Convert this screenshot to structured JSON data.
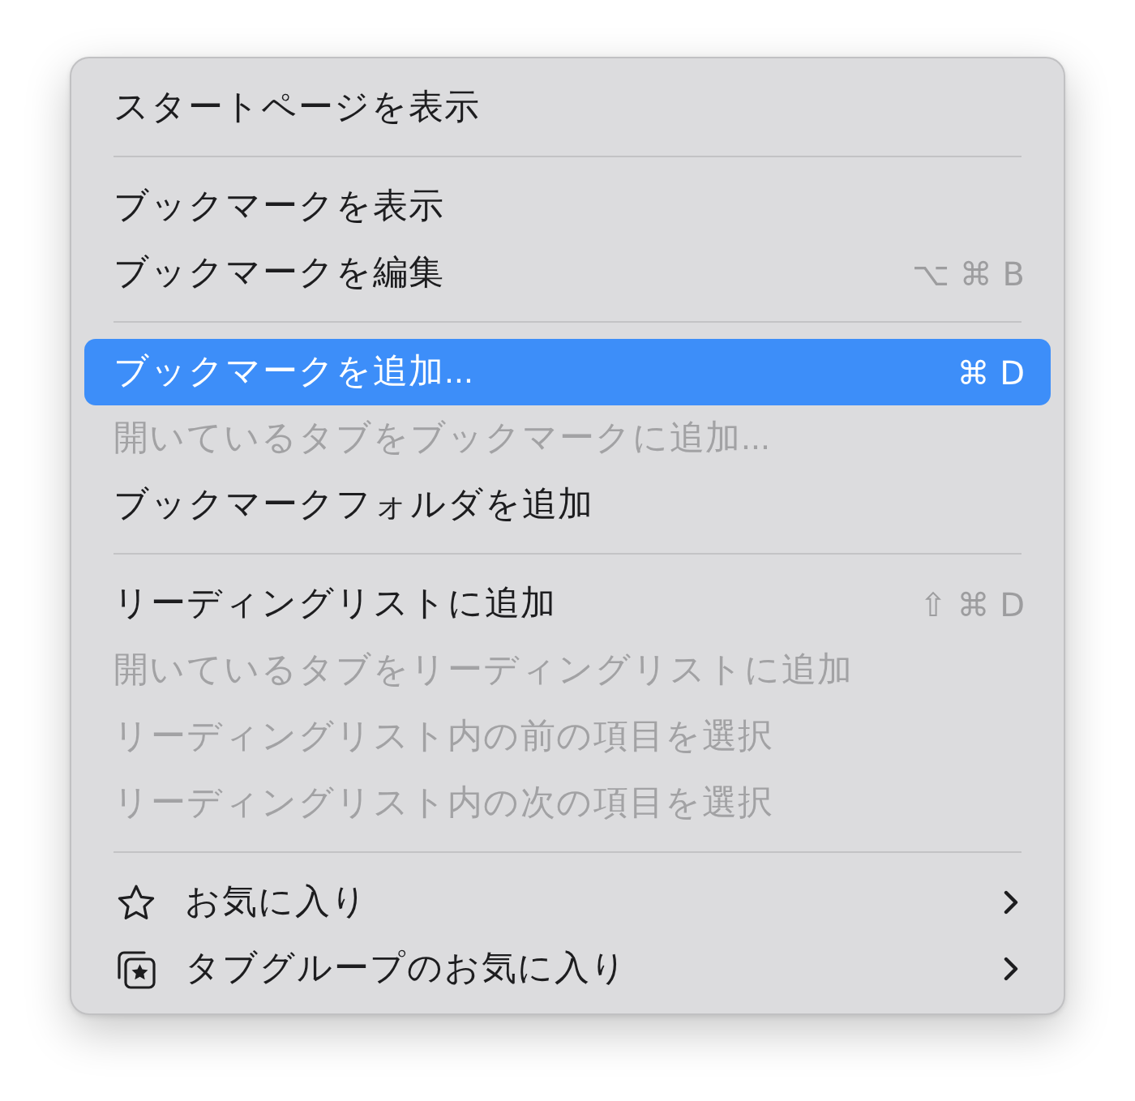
{
  "menu": {
    "sections": [
      {
        "items": [
          {
            "label": "スタートページを表示",
            "kind": "command",
            "submenu": false,
            "disabled": false,
            "selected": false
          }
        ]
      },
      {
        "items": [
          {
            "label": "ブックマークを表示",
            "kind": "command",
            "submenu": false,
            "disabled": false,
            "selected": false
          },
          {
            "label": "ブックマークを編集",
            "kind": "command",
            "shortcut": "⌥ ⌘ B",
            "submenu": false,
            "disabled": false,
            "selected": false
          }
        ]
      },
      {
        "items": [
          {
            "label": "ブックマークを追加...",
            "kind": "command",
            "shortcut": "⌘ D",
            "submenu": false,
            "disabled": false,
            "selected": true
          },
          {
            "label": "開いているタブをブックマークに追加...",
            "kind": "command",
            "submenu": false,
            "disabled": true,
            "selected": false
          },
          {
            "label": "ブックマークフォルダを追加",
            "kind": "command",
            "submenu": false,
            "disabled": false,
            "selected": false
          }
        ]
      },
      {
        "items": [
          {
            "label": "リーディングリストに追加",
            "kind": "command",
            "shortcut": "⇧ ⌘ D",
            "submenu": false,
            "disabled": false,
            "selected": false
          },
          {
            "label": "開いているタブをリーディングリストに追加",
            "kind": "command",
            "submenu": false,
            "disabled": true,
            "selected": false
          },
          {
            "label": "リーディングリスト内の前の項目を選択",
            "kind": "command",
            "submenu": false,
            "disabled": true,
            "selected": false
          },
          {
            "label": "リーディングリスト内の次の項目を選択",
            "kind": "command",
            "submenu": false,
            "disabled": true,
            "selected": false
          }
        ]
      },
      {
        "items": [
          {
            "label": "お気に入り",
            "kind": "starred",
            "submenu": true,
            "disabled": false,
            "selected": false
          },
          {
            "label": "タブグループのお気に入り",
            "kind": "tabgroup",
            "submenu": true,
            "disabled": false,
            "selected": false
          }
        ]
      }
    ]
  }
}
